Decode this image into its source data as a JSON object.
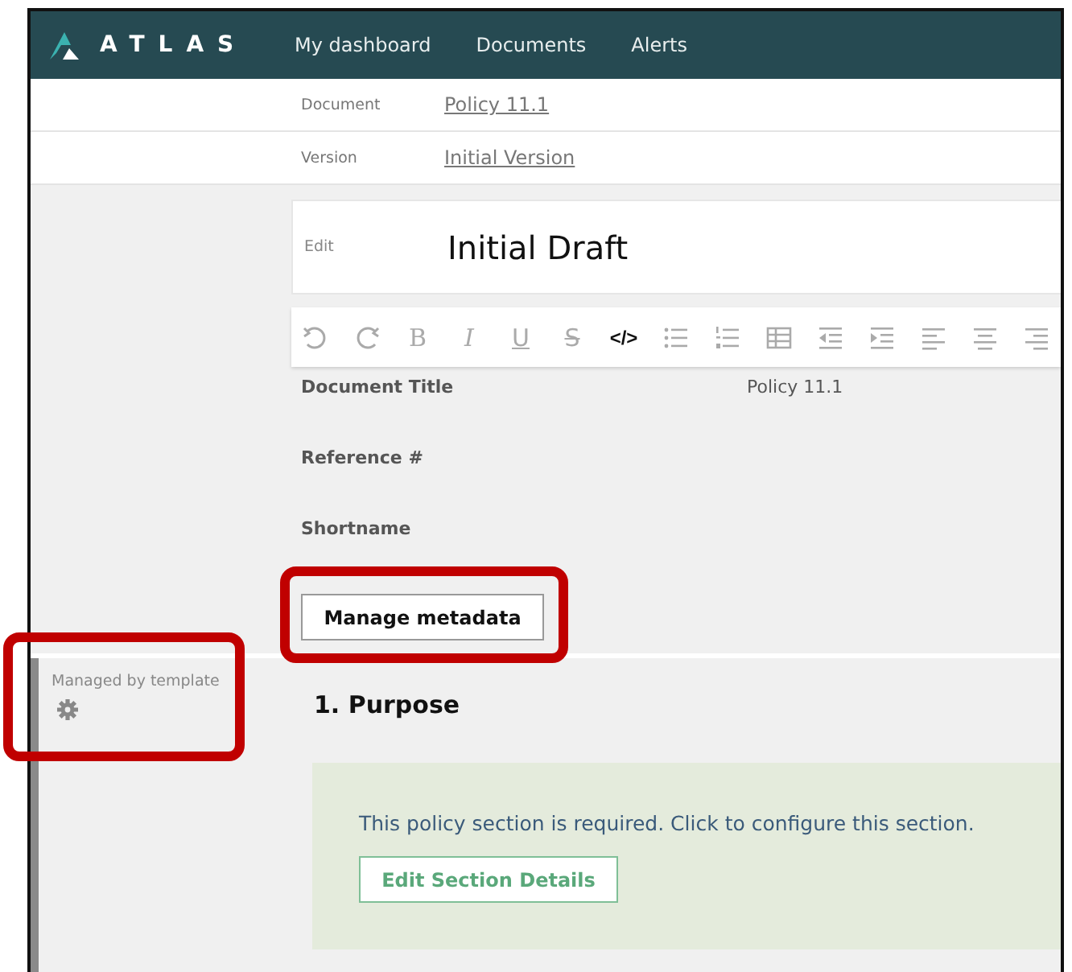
{
  "brand": "ATLAS",
  "nav": [
    {
      "label": "My dashboard"
    },
    {
      "label": "Documents"
    },
    {
      "label": "Alerts"
    }
  ],
  "breadcrumb": [
    {
      "label": "Document",
      "value": "Policy 11.1"
    },
    {
      "label": "Version",
      "value": "Initial Version"
    }
  ],
  "editor": {
    "label": "Edit",
    "title": "Initial Draft",
    "toolbar": [
      {
        "kind": "undo",
        "disabled": true
      },
      {
        "kind": "redo",
        "disabled": true
      },
      {
        "kind": "bold",
        "label": "B",
        "disabled": true
      },
      {
        "kind": "italic",
        "label": "I",
        "disabled": true
      },
      {
        "kind": "underline",
        "label": "U",
        "disabled": true
      },
      {
        "kind": "strike",
        "label": "S",
        "disabled": true
      },
      {
        "kind": "code",
        "label": "</>",
        "disabled": false
      },
      {
        "kind": "bullets",
        "disabled": true
      },
      {
        "kind": "numbers",
        "disabled": true
      },
      {
        "kind": "table",
        "disabled": true
      },
      {
        "kind": "outdent",
        "disabled": true
      },
      {
        "kind": "indent",
        "disabled": true
      },
      {
        "kind": "align-left",
        "disabled": true
      },
      {
        "kind": "align-center",
        "disabled": true
      },
      {
        "kind": "align-right",
        "disabled": true
      }
    ]
  },
  "metadata": [
    {
      "label": "Document Title",
      "value": "Policy 11.1"
    },
    {
      "label": "Reference #"
    },
    {
      "label": "Shortname"
    }
  ],
  "manage_button": "Manage metadata",
  "section": {
    "note": "Managed by template",
    "title": "1. Purpose",
    "message": "This policy section is required. Click to configure this section.",
    "button": "Edit Section Details"
  }
}
